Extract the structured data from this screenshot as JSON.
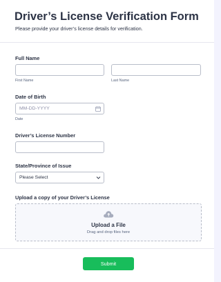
{
  "form": {
    "title": "Driver’s License Verification Form",
    "subtitle": "Please provide your driver’s license details for verification."
  },
  "full_name": {
    "label": "Full Name",
    "first_sublabel": "First Name",
    "last_sublabel": "Last Name",
    "first_value": "",
    "last_value": ""
  },
  "dob": {
    "label": "Date of Birth",
    "placeholder": "MM-DD-YYYY",
    "sublabel": "Date",
    "icon": "calendar-icon"
  },
  "license": {
    "label": "Driver’s License Number",
    "value": ""
  },
  "state": {
    "label": "State/Province of Issue",
    "selected": "Please Select",
    "icon": "chevron-down-icon"
  },
  "upload": {
    "label": "Upload a copy of your Driver’s License",
    "title": "Upload a File",
    "subtitle": "Drag and drop files here",
    "icon": "cloud-upload-icon"
  },
  "submit": {
    "label": "Submit"
  },
  "colors": {
    "accent": "#18bd5b",
    "text": "#2c3345",
    "border": "#b8bdc9"
  }
}
